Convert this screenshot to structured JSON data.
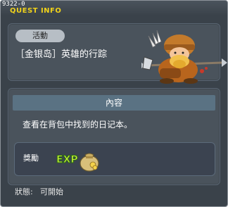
{
  "window": {
    "quest_id": "9322-0",
    "title": "QUEST INFO"
  },
  "quest": {
    "badge": "活動",
    "name": "［金银岛］英雄的行踪",
    "npc_icon": "dwarf-warrior-npc-icon"
  },
  "content": {
    "header": "內容",
    "text": "查看在背包中找到的日记本。"
  },
  "reward": {
    "label": "獎勵",
    "exp_icon": "EXP",
    "bag_icon": "meso-bag-icon"
  },
  "status": {
    "label": "狀態:",
    "value": "可開始"
  },
  "colors": {
    "title": "#f0d21a",
    "panel": "#4a535c",
    "header": "#5a7283",
    "background": "#3a424a"
  }
}
